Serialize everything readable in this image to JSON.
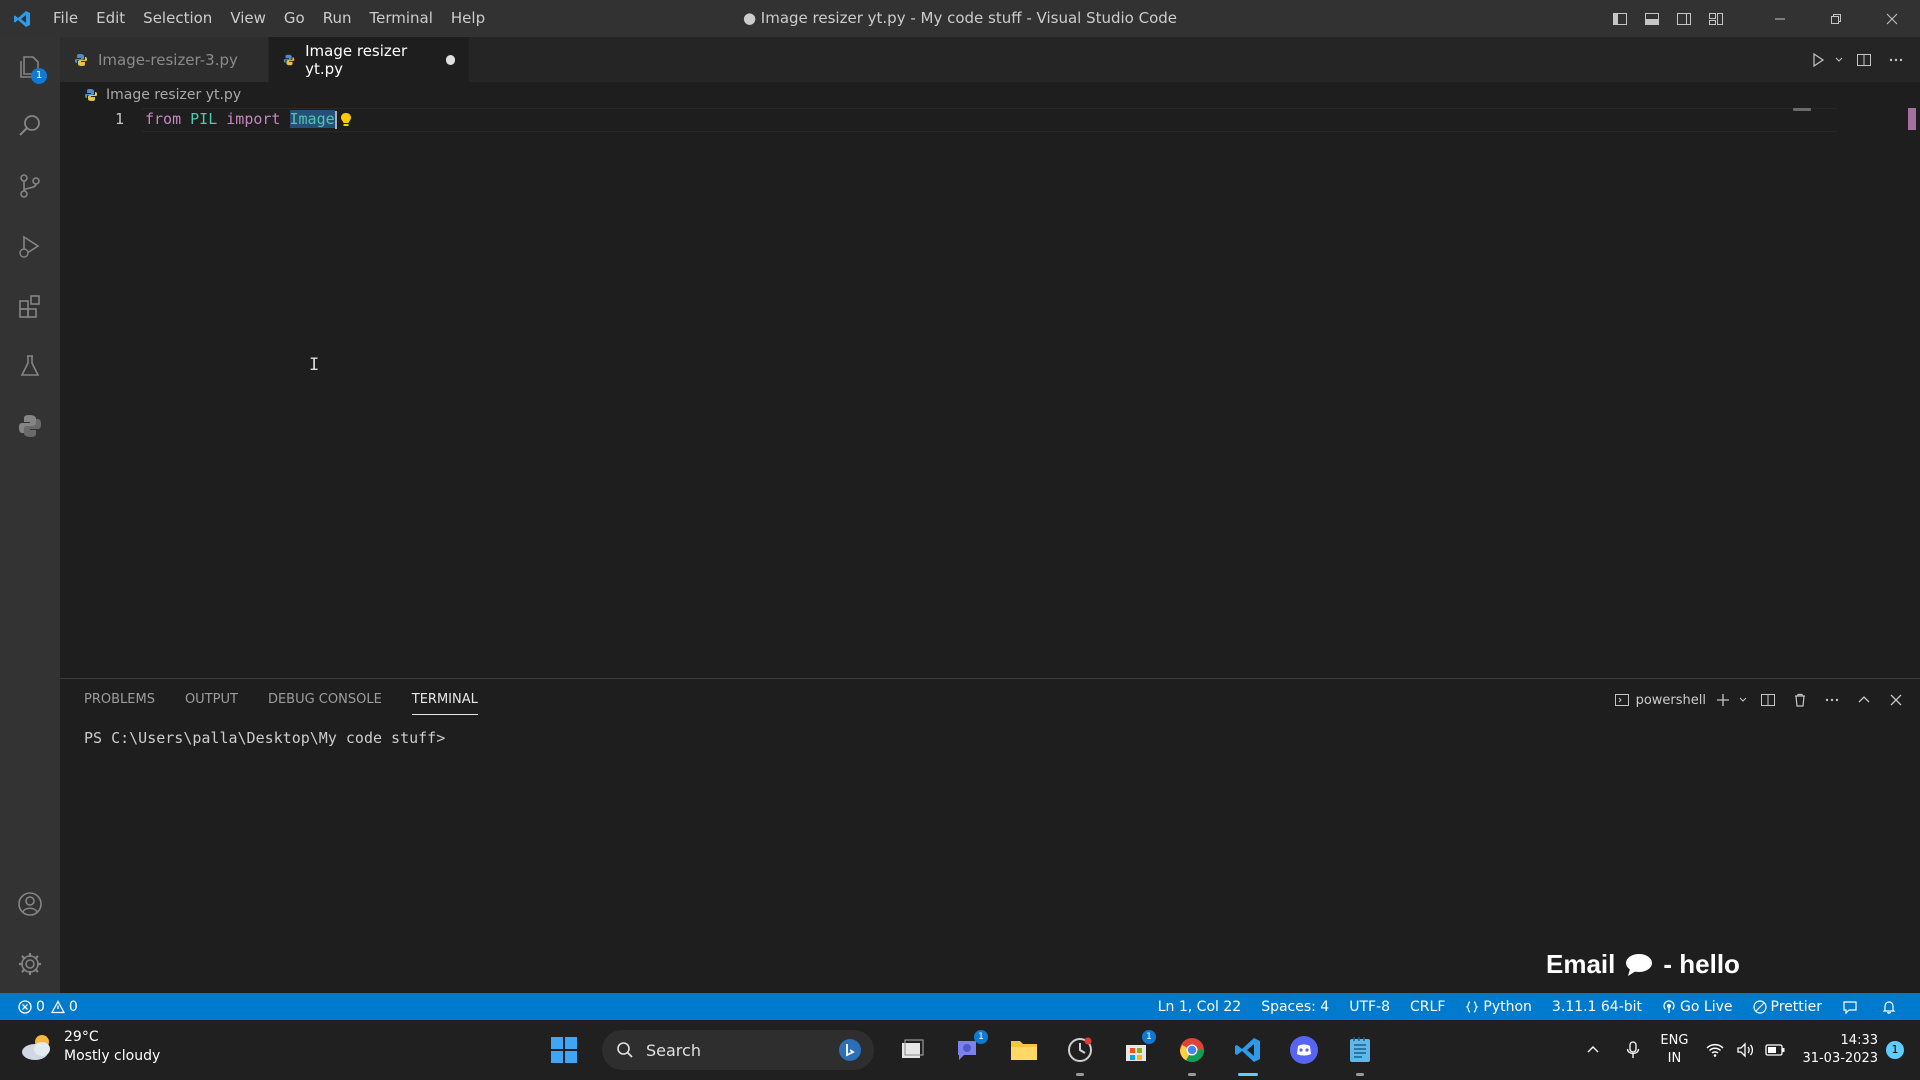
{
  "titlebar": {
    "menu": [
      "File",
      "Edit",
      "Selection",
      "View",
      "Go",
      "Run",
      "Terminal",
      "Help"
    ],
    "window_title": "● Image resizer yt.py - My code stuff - Visual Studio Code"
  },
  "activity": {
    "explorer_badge": "1"
  },
  "tabs": [
    {
      "label": "Image-resizer-3.py",
      "active": false
    },
    {
      "label": "Image resizer yt.py",
      "active": true,
      "dirty": true
    }
  ],
  "breadcrumb": {
    "file": "Image resizer yt.py"
  },
  "editor": {
    "line_number": "1",
    "tokens": {
      "from": "from",
      "module": "PIL",
      "import": "import",
      "name": "Image"
    }
  },
  "panel": {
    "tabs": [
      "PROBLEMS",
      "OUTPUT",
      "DEBUG CONSOLE",
      "TERMINAL"
    ],
    "active_tab": "TERMINAL",
    "shell": "powershell",
    "prompt": "PS C:\\Users\\palla\\Desktop\\My code stuff>"
  },
  "overlay": {
    "left": "Email",
    "right": "- hello"
  },
  "statusbar": {
    "errors": "0",
    "warnings": "0",
    "position": "Ln 1, Col 22",
    "spaces": "Spaces: 4",
    "encoding": "UTF-8",
    "eol": "CRLF",
    "language": "Python",
    "interpreter": "3.11.1 64-bit",
    "golive": "Go Live",
    "prettier": "Prettier"
  },
  "taskbar": {
    "temperature": "29°C",
    "weather": "Mostly cloudy",
    "search_placeholder": "Search",
    "teams_badge": "1",
    "store_badge": "1",
    "lang_top": "ENG",
    "lang_bottom": "IN",
    "time": "14:33",
    "date": "31-03-2023",
    "notification_count": "1"
  },
  "colors": {
    "accent": "#007acc",
    "keyword": "#c586c0",
    "type": "#4ec9b0",
    "selection": "#264f78"
  }
}
